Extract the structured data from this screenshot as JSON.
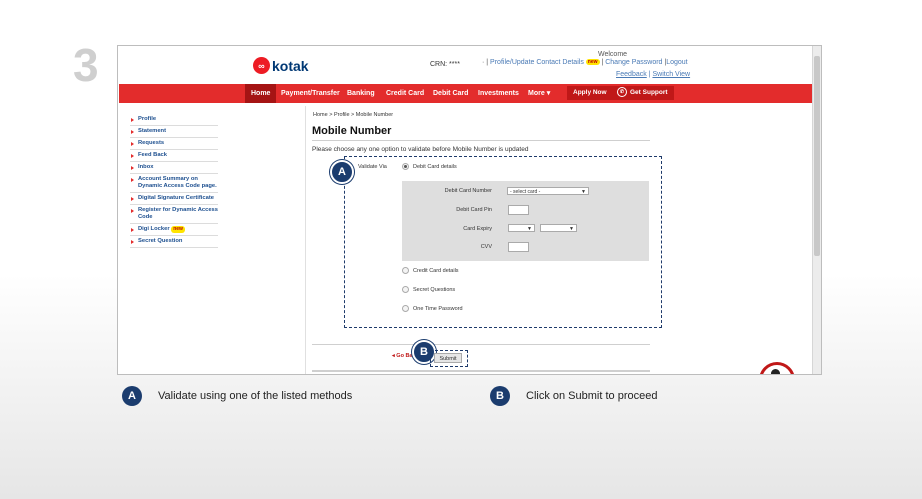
{
  "step": "3",
  "header": {
    "logo_text": "kotak",
    "crn": "CRN: ****",
    "welcome": "Welcome",
    "profile_link": "Profile/Update Contact Details",
    "new_badge": "new",
    "change_password": "Change Password",
    "logout": "Logout",
    "feedback": "Feedback",
    "switch_view": "Switch View"
  },
  "nav": {
    "items": [
      "Home",
      "Payment/Transfer",
      "Banking",
      "Credit Card",
      "Debit Card",
      "Investments",
      "More"
    ],
    "apply_now": "Apply Now",
    "get_support": "Get Support"
  },
  "sidebar": {
    "items": [
      "Profile",
      "Statement",
      "Requests",
      "Feed Back",
      "Inbox",
      "Account Summary on Dynamic Access Code page.",
      "Digital Signature Certificate",
      "Register for Dynamic Access Code",
      "Digi Locker",
      "Secret Question"
    ]
  },
  "main": {
    "breadcrumb": "Home > Profile > Mobile Number",
    "title": "Mobile Number",
    "instruction": "Please choose any one option to validate before Mobile Number is updated",
    "validate_via": "Validate Via",
    "options": [
      "Debit Card details",
      "Credit Card details",
      "Secret Questions",
      "One Time Password"
    ],
    "selected_option": "Debit Card details",
    "fields": {
      "card_number_label": "Debit Card Number",
      "card_number_value": "- select card -",
      "pin_label": "Debit Card Pin",
      "expiry_label": "Card Expiry",
      "cvv_label": "CVV"
    },
    "go_back": "Go Back",
    "submit": "Submit"
  },
  "callouts": {
    "a_badge": "A",
    "b_badge": "B",
    "a_text": "Validate using one of the listed methods",
    "b_text": "Click on Submit to proceed"
  },
  "colors": {
    "nav_red": "#e32c2c",
    "badge_navy": "#1b3c6e",
    "link_blue": "#4a7ab5"
  }
}
